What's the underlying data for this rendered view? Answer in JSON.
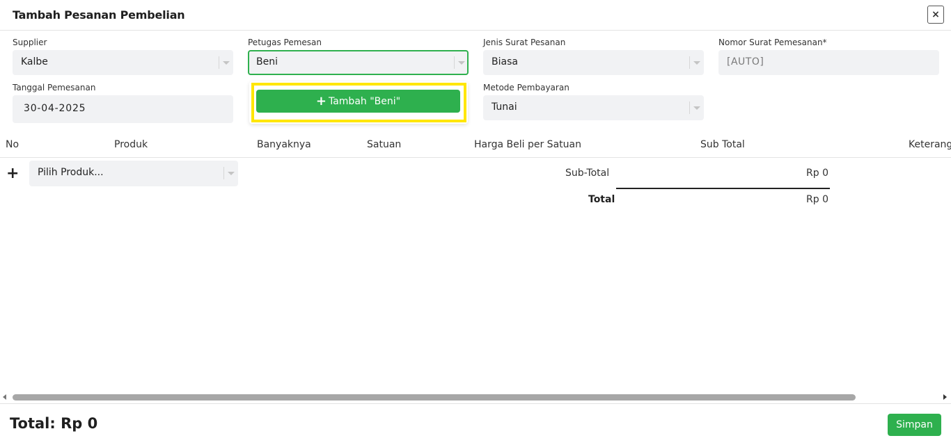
{
  "dialog": {
    "title": "Tambah Pesanan Pembelian",
    "close_label": "×"
  },
  "form": {
    "supplier": {
      "label": "Supplier",
      "value": "Kalbe"
    },
    "petugas": {
      "label": "Petugas Pemesan",
      "value": "Beni"
    },
    "jenis_surat": {
      "label": "Jenis Surat Pesanan",
      "value": "Biasa"
    },
    "nomor_surat": {
      "label": "Nomor Surat Pemesanan*",
      "value": "[AUTO]"
    },
    "tanggal": {
      "label": "Tanggal Pemesanan",
      "value": "30-04-2025"
    },
    "metode": {
      "label": "Metode Pembayaran",
      "value": "Tunai"
    }
  },
  "dropdown": {
    "add_label": "Tambah \"Beni\"",
    "add_icon": "plus-icon"
  },
  "table": {
    "headers": [
      "No",
      "Produk",
      "Banyaknya",
      "Satuan",
      "Harga Beli per Satuan",
      "Sub Total",
      "Keterang"
    ],
    "product_placeholder": "Pilih Produk...",
    "add_row_icon": "+"
  },
  "summary": {
    "subtotal_label": "Sub-Total",
    "subtotal_value": "Rp 0",
    "total_label": "Total",
    "total_value": "Rp 0"
  },
  "footer": {
    "total_text": "Total: Rp 0",
    "save_label": "Simpan"
  },
  "colors": {
    "accent_green": "#2eb04e",
    "highlight_yellow": "#ffe600",
    "field_bg": "#f1f2f4"
  }
}
